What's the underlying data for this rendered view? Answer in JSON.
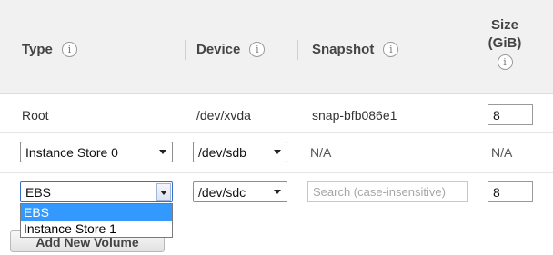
{
  "header": {
    "type_label": "Type",
    "device_label": "Device",
    "snapshot_label": "Snapshot",
    "size_label_line1": "Size",
    "size_label_line2": "(GiB)",
    "info_glyph": "i"
  },
  "rows": [
    {
      "type": "Root",
      "device": "/dev/xvda",
      "snapshot": "snap-bfb086e1",
      "size": "8"
    },
    {
      "type": "Instance Store 0",
      "device": "/dev/sdb",
      "snapshot": "N/A",
      "size": "N/A"
    },
    {
      "type": "EBS",
      "device": "/dev/sdc",
      "snapshot_placeholder": "Search (case-insensitive)",
      "size": "8"
    }
  ],
  "type_dropdown": {
    "options": [
      "EBS",
      "Instance Store 1"
    ],
    "highlighted_index": 0
  },
  "add_volume_button": "Add New Volume",
  "colors": {
    "header_bg": "#f1f1f1",
    "highlight": "#3399ff",
    "focus_border": "#3b6fc6"
  }
}
